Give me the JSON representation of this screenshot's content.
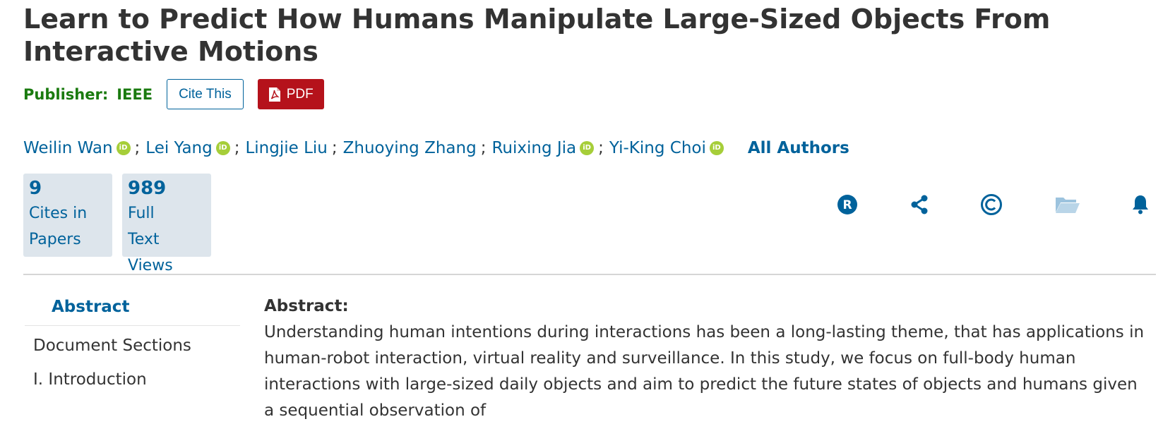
{
  "article": {
    "title": "Learn to Predict How Humans Manipulate Large-Sized Objects From Interactive Motions"
  },
  "publisher": {
    "label": "Publisher:",
    "name": "IEEE"
  },
  "actions": {
    "cite_label": "Cite This",
    "pdf_label": "PDF"
  },
  "authors": {
    "list": [
      {
        "name": "Weilin Wan",
        "orcid": true
      },
      {
        "name": "Lei Yang",
        "orcid": true
      },
      {
        "name": "Lingjie Liu",
        "orcid": false
      },
      {
        "name": "Zhuoying Zhang",
        "orcid": false
      },
      {
        "name": "Ruixing Jia",
        "orcid": true
      },
      {
        "name": "Yi-King Choi",
        "orcid": true
      }
    ],
    "separator": ";",
    "orcid_badge": "iD",
    "all_authors_label": "All Authors"
  },
  "metrics": {
    "cites": {
      "value": "9",
      "label": "Cites in Papers"
    },
    "views": {
      "value": "989",
      "label": "Full Text Views"
    }
  },
  "toolbar_icons": [
    "rights-icon",
    "share-icon",
    "copyright-icon",
    "folder-icon",
    "bell-icon"
  ],
  "colors": {
    "link": "#00629b",
    "publisher": "#1a7a0f",
    "pdf": "#b5121b",
    "orcid": "#a6ce39",
    "metric_bg": "#dde5ec"
  },
  "nav": {
    "abstract_label": "Abstract",
    "sections_label": "Document Sections",
    "next_label": "I. Introduction"
  },
  "abstract": {
    "heading": "Abstract:",
    "text": "Understanding human intentions during interactions has been a long-lasting theme, that has applications in human-robot interaction, virtual reality and surveillance. In this study, we focus on full-body human interactions with large-sized daily objects and aim to predict the future states of objects and humans given a sequential observation of"
  }
}
